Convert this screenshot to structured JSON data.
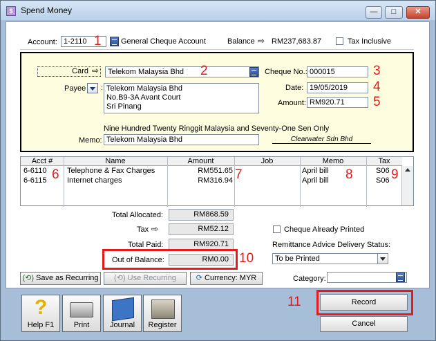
{
  "window": {
    "title": "Spend Money",
    "icon": "app-icon",
    "min_label": "—",
    "max_label": "□",
    "close_label": "✕"
  },
  "account": {
    "label": "Account:",
    "number": "1-2110",
    "name": "General Cheque Account",
    "balance_label": "Balance",
    "balance_value": "RM237,683.87",
    "tax_inclusive_label": "Tax Inclusive"
  },
  "cheque": {
    "card_label": "Card",
    "card_value": "Telekom Malaysia Bhd",
    "payee_label": "Payee",
    "payee_lines": [
      "Telekom Malaysia Bhd",
      "No.B9-3A Avant Court",
      "Sri Pinang"
    ],
    "cheque_no_label": "Cheque No.:",
    "cheque_no": "000015",
    "date_label": "Date:",
    "date": "19/05/2019",
    "amount_label": "Amount:",
    "amount": "RM920.71",
    "amount_words": "Nine Hundred Twenty Ringgit Malaysia and Seventy-One Sen Only",
    "memo_label": "Memo:",
    "memo": "Telekom Malaysia Bhd",
    "signature": "Clearwater Sdn Bhd"
  },
  "table": {
    "headers": [
      "Acct #",
      "Name",
      "Amount",
      "Job",
      "Memo",
      "Tax"
    ],
    "rows": [
      {
        "acct": "6-6110",
        "name": "Telephone & Fax Charges",
        "amount": "RM551.65",
        "job": "",
        "memo": "April bill",
        "tax": "S06"
      },
      {
        "acct": "6-6115",
        "name": "Internet charges",
        "amount": "RM316.94",
        "job": "",
        "memo": "April bill",
        "tax": "S06"
      }
    ]
  },
  "totals": {
    "allocated_label": "Total Allocated:",
    "allocated": "RM868.59",
    "tax_label": "Tax",
    "tax": "RM52.12",
    "paid_label": "Total Paid:",
    "paid": "RM920.71",
    "oob_label": "Out of Balance:",
    "oob": "RM0.00"
  },
  "options": {
    "cheque_printed_label": "Cheque Already Printed",
    "remittance_label": "Remittance Advice Delivery Status:",
    "remittance_value": "To be Printed"
  },
  "actions": {
    "save_recurring": "Save as Recurring",
    "use_recurring": "Use Recurring",
    "currency_label": "Currency:",
    "currency": "MYR",
    "category_label": "Category:",
    "record": "Record",
    "cancel": "Cancel"
  },
  "toolbar": {
    "help": "Help F1",
    "print": "Print",
    "journal": "Journal",
    "register": "Register"
  },
  "annotations": [
    "1",
    "2",
    "3",
    "4",
    "5",
    "6",
    "7",
    "8",
    "9",
    "10",
    "11"
  ],
  "colors": {
    "accent_red": "#e8191a",
    "cheque_bg": "#fffde0",
    "frame": "#a7bed8"
  }
}
